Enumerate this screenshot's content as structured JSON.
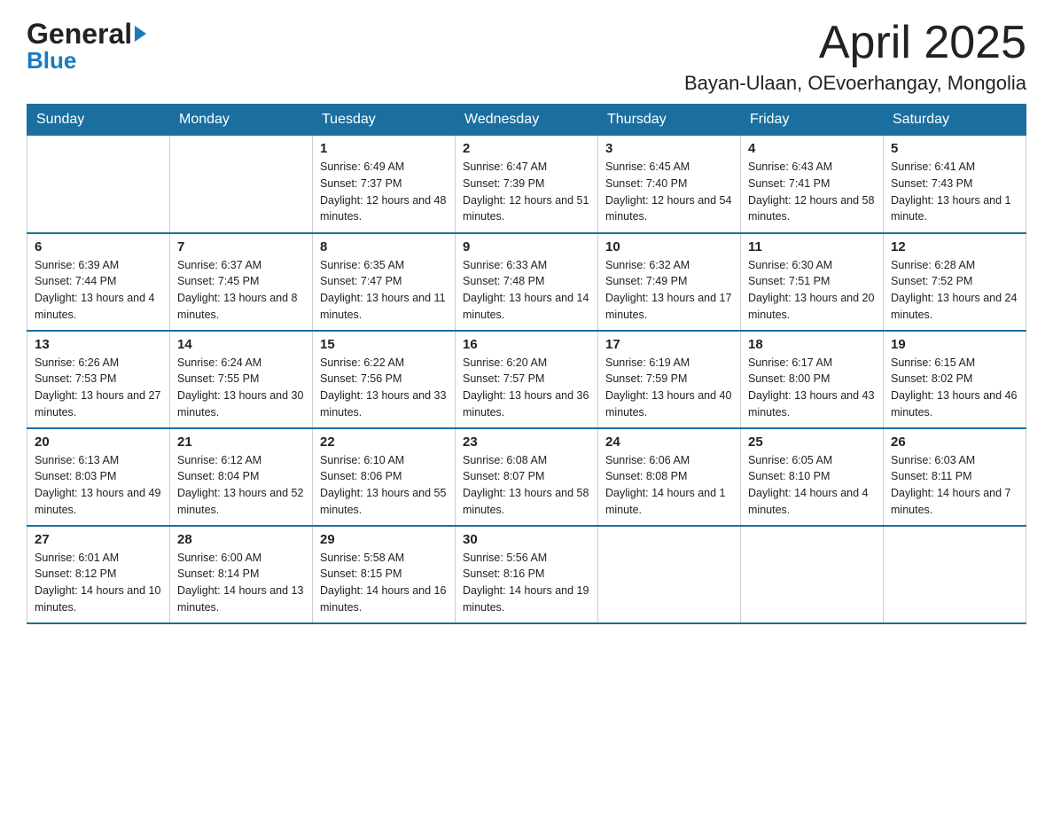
{
  "logo": {
    "general": "General",
    "blue": "Blue",
    "triangle": "▶"
  },
  "header": {
    "month_year": "April 2025",
    "location": "Bayan-Ulaan, OEvoerhangay, Mongolia"
  },
  "weekdays": [
    "Sunday",
    "Monday",
    "Tuesday",
    "Wednesday",
    "Thursday",
    "Friday",
    "Saturday"
  ],
  "weeks": [
    [
      {
        "day": "",
        "sunrise": "",
        "sunset": "",
        "daylight": ""
      },
      {
        "day": "",
        "sunrise": "",
        "sunset": "",
        "daylight": ""
      },
      {
        "day": "1",
        "sunrise": "Sunrise: 6:49 AM",
        "sunset": "Sunset: 7:37 PM",
        "daylight": "Daylight: 12 hours and 48 minutes."
      },
      {
        "day": "2",
        "sunrise": "Sunrise: 6:47 AM",
        "sunset": "Sunset: 7:39 PM",
        "daylight": "Daylight: 12 hours and 51 minutes."
      },
      {
        "day": "3",
        "sunrise": "Sunrise: 6:45 AM",
        "sunset": "Sunset: 7:40 PM",
        "daylight": "Daylight: 12 hours and 54 minutes."
      },
      {
        "day": "4",
        "sunrise": "Sunrise: 6:43 AM",
        "sunset": "Sunset: 7:41 PM",
        "daylight": "Daylight: 12 hours and 58 minutes."
      },
      {
        "day": "5",
        "sunrise": "Sunrise: 6:41 AM",
        "sunset": "Sunset: 7:43 PM",
        "daylight": "Daylight: 13 hours and 1 minute."
      }
    ],
    [
      {
        "day": "6",
        "sunrise": "Sunrise: 6:39 AM",
        "sunset": "Sunset: 7:44 PM",
        "daylight": "Daylight: 13 hours and 4 minutes."
      },
      {
        "day": "7",
        "sunrise": "Sunrise: 6:37 AM",
        "sunset": "Sunset: 7:45 PM",
        "daylight": "Daylight: 13 hours and 8 minutes."
      },
      {
        "day": "8",
        "sunrise": "Sunrise: 6:35 AM",
        "sunset": "Sunset: 7:47 PM",
        "daylight": "Daylight: 13 hours and 11 minutes."
      },
      {
        "day": "9",
        "sunrise": "Sunrise: 6:33 AM",
        "sunset": "Sunset: 7:48 PM",
        "daylight": "Daylight: 13 hours and 14 minutes."
      },
      {
        "day": "10",
        "sunrise": "Sunrise: 6:32 AM",
        "sunset": "Sunset: 7:49 PM",
        "daylight": "Daylight: 13 hours and 17 minutes."
      },
      {
        "day": "11",
        "sunrise": "Sunrise: 6:30 AM",
        "sunset": "Sunset: 7:51 PM",
        "daylight": "Daylight: 13 hours and 20 minutes."
      },
      {
        "day": "12",
        "sunrise": "Sunrise: 6:28 AM",
        "sunset": "Sunset: 7:52 PM",
        "daylight": "Daylight: 13 hours and 24 minutes."
      }
    ],
    [
      {
        "day": "13",
        "sunrise": "Sunrise: 6:26 AM",
        "sunset": "Sunset: 7:53 PM",
        "daylight": "Daylight: 13 hours and 27 minutes."
      },
      {
        "day": "14",
        "sunrise": "Sunrise: 6:24 AM",
        "sunset": "Sunset: 7:55 PM",
        "daylight": "Daylight: 13 hours and 30 minutes."
      },
      {
        "day": "15",
        "sunrise": "Sunrise: 6:22 AM",
        "sunset": "Sunset: 7:56 PM",
        "daylight": "Daylight: 13 hours and 33 minutes."
      },
      {
        "day": "16",
        "sunrise": "Sunrise: 6:20 AM",
        "sunset": "Sunset: 7:57 PM",
        "daylight": "Daylight: 13 hours and 36 minutes."
      },
      {
        "day": "17",
        "sunrise": "Sunrise: 6:19 AM",
        "sunset": "Sunset: 7:59 PM",
        "daylight": "Daylight: 13 hours and 40 minutes."
      },
      {
        "day": "18",
        "sunrise": "Sunrise: 6:17 AM",
        "sunset": "Sunset: 8:00 PM",
        "daylight": "Daylight: 13 hours and 43 minutes."
      },
      {
        "day": "19",
        "sunrise": "Sunrise: 6:15 AM",
        "sunset": "Sunset: 8:02 PM",
        "daylight": "Daylight: 13 hours and 46 minutes."
      }
    ],
    [
      {
        "day": "20",
        "sunrise": "Sunrise: 6:13 AM",
        "sunset": "Sunset: 8:03 PM",
        "daylight": "Daylight: 13 hours and 49 minutes."
      },
      {
        "day": "21",
        "sunrise": "Sunrise: 6:12 AM",
        "sunset": "Sunset: 8:04 PM",
        "daylight": "Daylight: 13 hours and 52 minutes."
      },
      {
        "day": "22",
        "sunrise": "Sunrise: 6:10 AM",
        "sunset": "Sunset: 8:06 PM",
        "daylight": "Daylight: 13 hours and 55 minutes."
      },
      {
        "day": "23",
        "sunrise": "Sunrise: 6:08 AM",
        "sunset": "Sunset: 8:07 PM",
        "daylight": "Daylight: 13 hours and 58 minutes."
      },
      {
        "day": "24",
        "sunrise": "Sunrise: 6:06 AM",
        "sunset": "Sunset: 8:08 PM",
        "daylight": "Daylight: 14 hours and 1 minute."
      },
      {
        "day": "25",
        "sunrise": "Sunrise: 6:05 AM",
        "sunset": "Sunset: 8:10 PM",
        "daylight": "Daylight: 14 hours and 4 minutes."
      },
      {
        "day": "26",
        "sunrise": "Sunrise: 6:03 AM",
        "sunset": "Sunset: 8:11 PM",
        "daylight": "Daylight: 14 hours and 7 minutes."
      }
    ],
    [
      {
        "day": "27",
        "sunrise": "Sunrise: 6:01 AM",
        "sunset": "Sunset: 8:12 PM",
        "daylight": "Daylight: 14 hours and 10 minutes."
      },
      {
        "day": "28",
        "sunrise": "Sunrise: 6:00 AM",
        "sunset": "Sunset: 8:14 PM",
        "daylight": "Daylight: 14 hours and 13 minutes."
      },
      {
        "day": "29",
        "sunrise": "Sunrise: 5:58 AM",
        "sunset": "Sunset: 8:15 PM",
        "daylight": "Daylight: 14 hours and 16 minutes."
      },
      {
        "day": "30",
        "sunrise": "Sunrise: 5:56 AM",
        "sunset": "Sunset: 8:16 PM",
        "daylight": "Daylight: 14 hours and 19 minutes."
      },
      {
        "day": "",
        "sunrise": "",
        "sunset": "",
        "daylight": ""
      },
      {
        "day": "",
        "sunrise": "",
        "sunset": "",
        "daylight": ""
      },
      {
        "day": "",
        "sunrise": "",
        "sunset": "",
        "daylight": ""
      }
    ]
  ]
}
